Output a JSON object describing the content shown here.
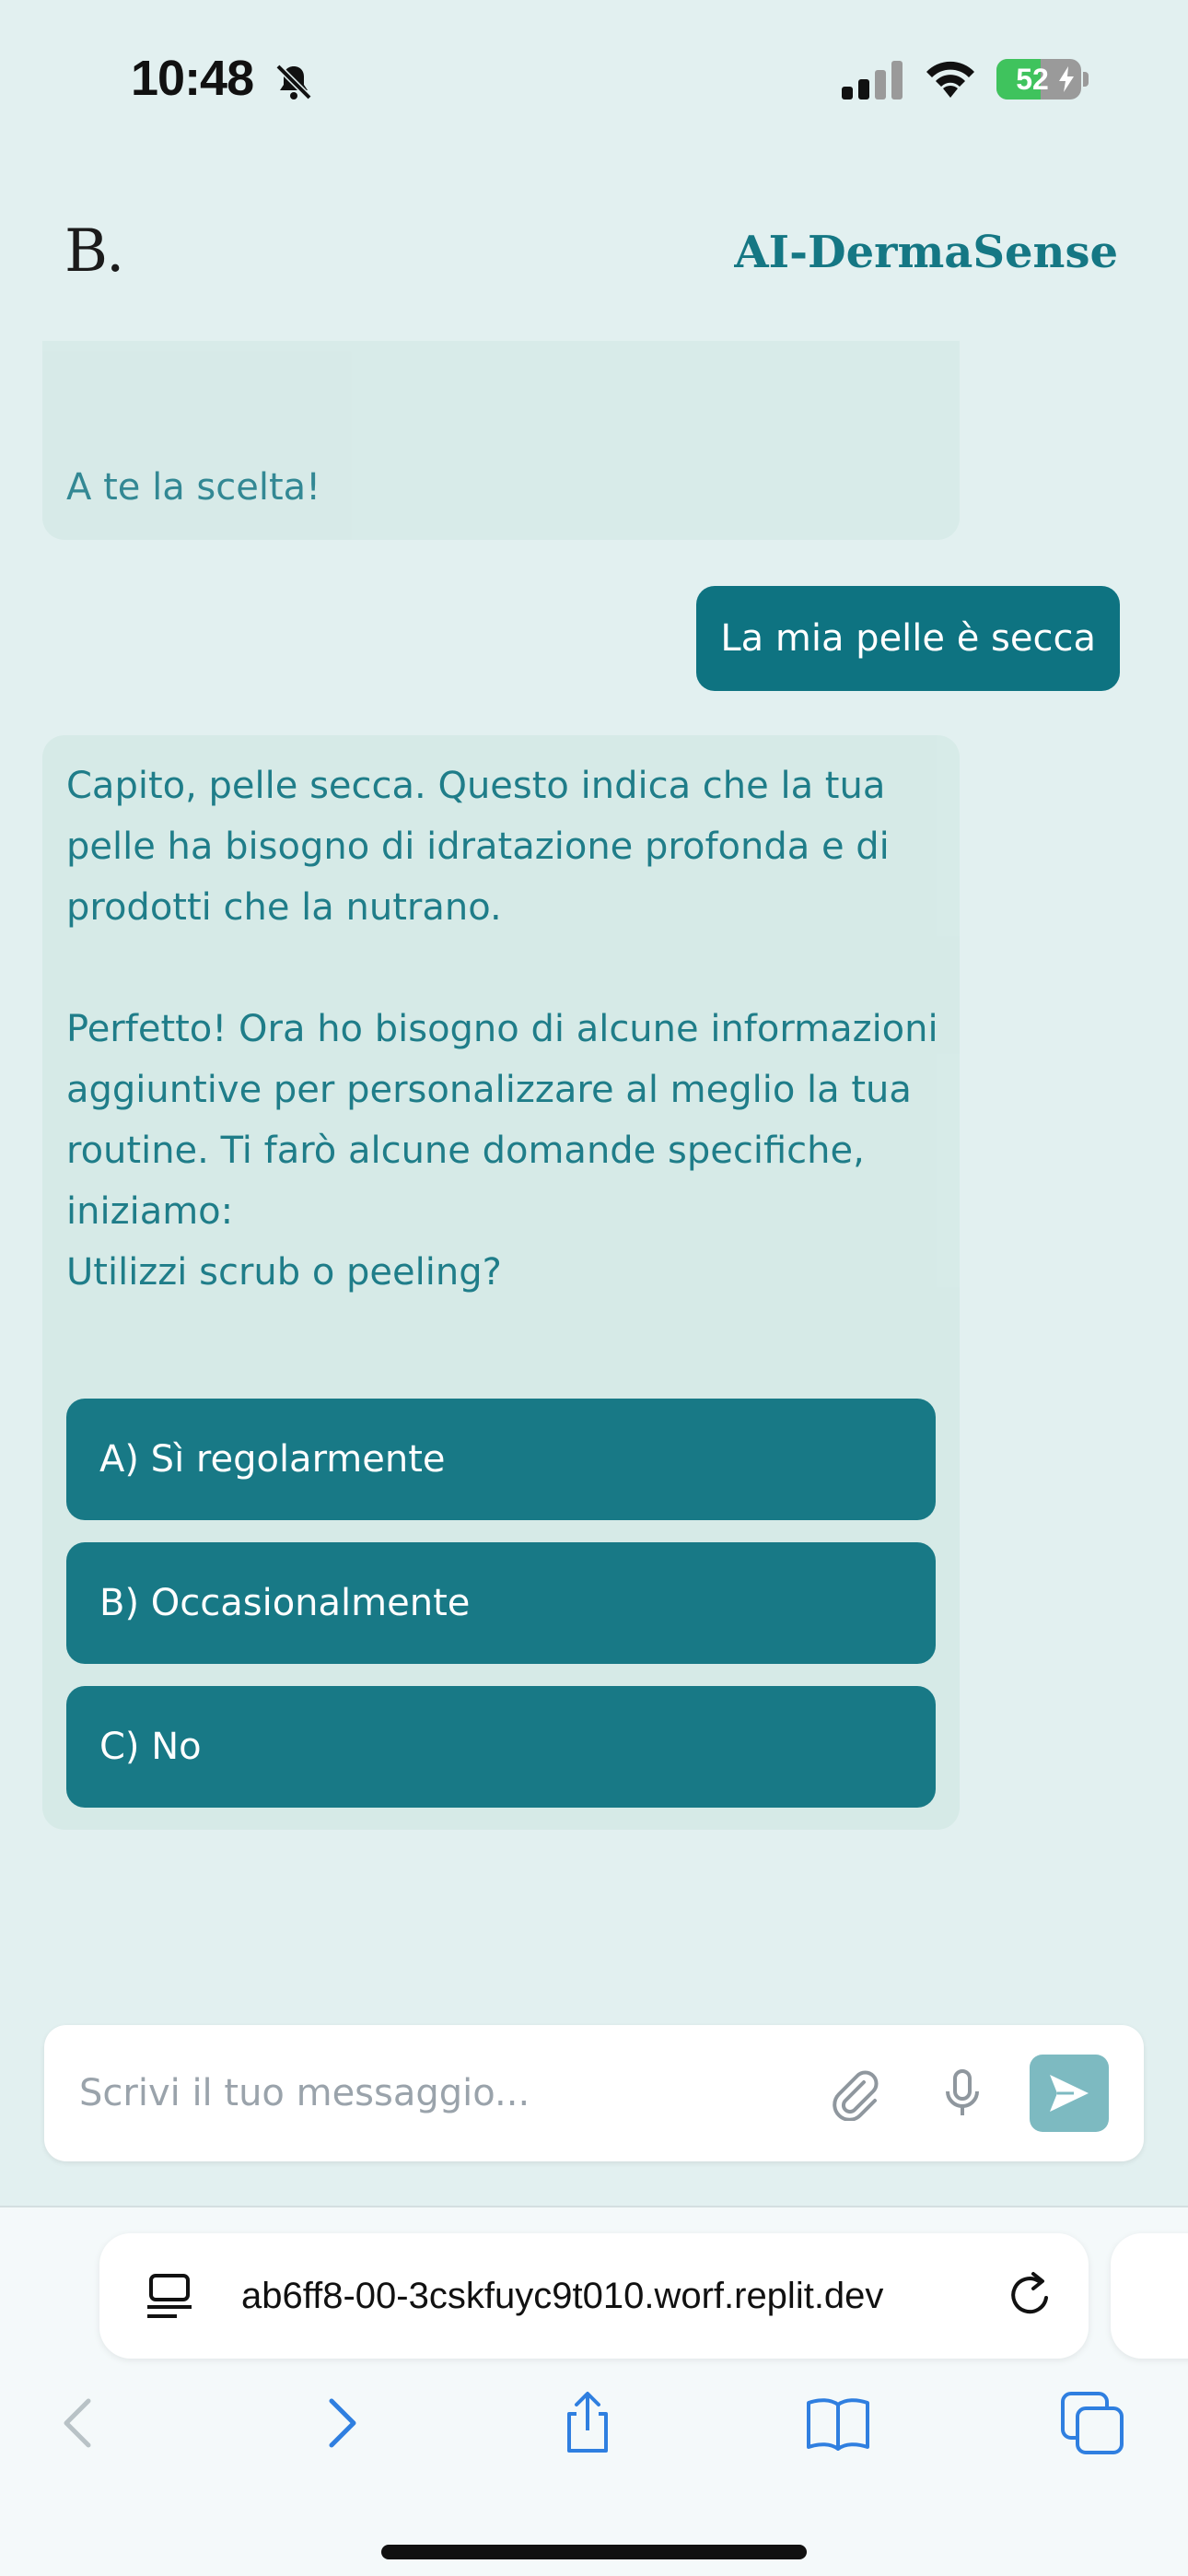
{
  "status_bar": {
    "time": "10:48",
    "battery_percent": "52",
    "battery_level": 0.52
  },
  "header": {
    "logo": "B.",
    "brand": "AI-DermaSense"
  },
  "chat": {
    "messages_top": {
      "text": "A te la scelta!"
    },
    "user_message": "La mia pelle è secca",
    "bot_message": {
      "paragraphs": [
        "Capito, pelle secca. Questo indica che la tua pelle ha bisogno di idratazione profonda e di prodotti che la nutrano.",
        "Perfetto! Ora ho bisogno di alcune informazioni aggiuntive per personalizzare al meglio la tua routine. Ti farò alcune domande specifiche, iniziamo:",
        "Utilizzi scrub o peeling?"
      ],
      "options": [
        "A) Sì regolarmente",
        "B) Occasionalmente",
        "C) No"
      ]
    }
  },
  "composer": {
    "placeholder": "Scrivi il tuo messaggio..."
  },
  "browser": {
    "url": "ab6ff8-00-3cskfuyc9t010.worf.replit.dev"
  },
  "colors": {
    "background": "#e2f0f0",
    "accent": "#0e7381",
    "bot_bubble": "#d6eae7",
    "send_button": "#7dbac1"
  },
  "icons": [
    "bell-slash-icon",
    "signal-icon",
    "wifi-icon",
    "battery-icon",
    "paperclip-icon",
    "microphone-icon",
    "send-icon",
    "reader-icon",
    "reload-icon",
    "back-icon",
    "forward-icon",
    "share-icon",
    "bookmarks-icon",
    "tabs-icon"
  ]
}
